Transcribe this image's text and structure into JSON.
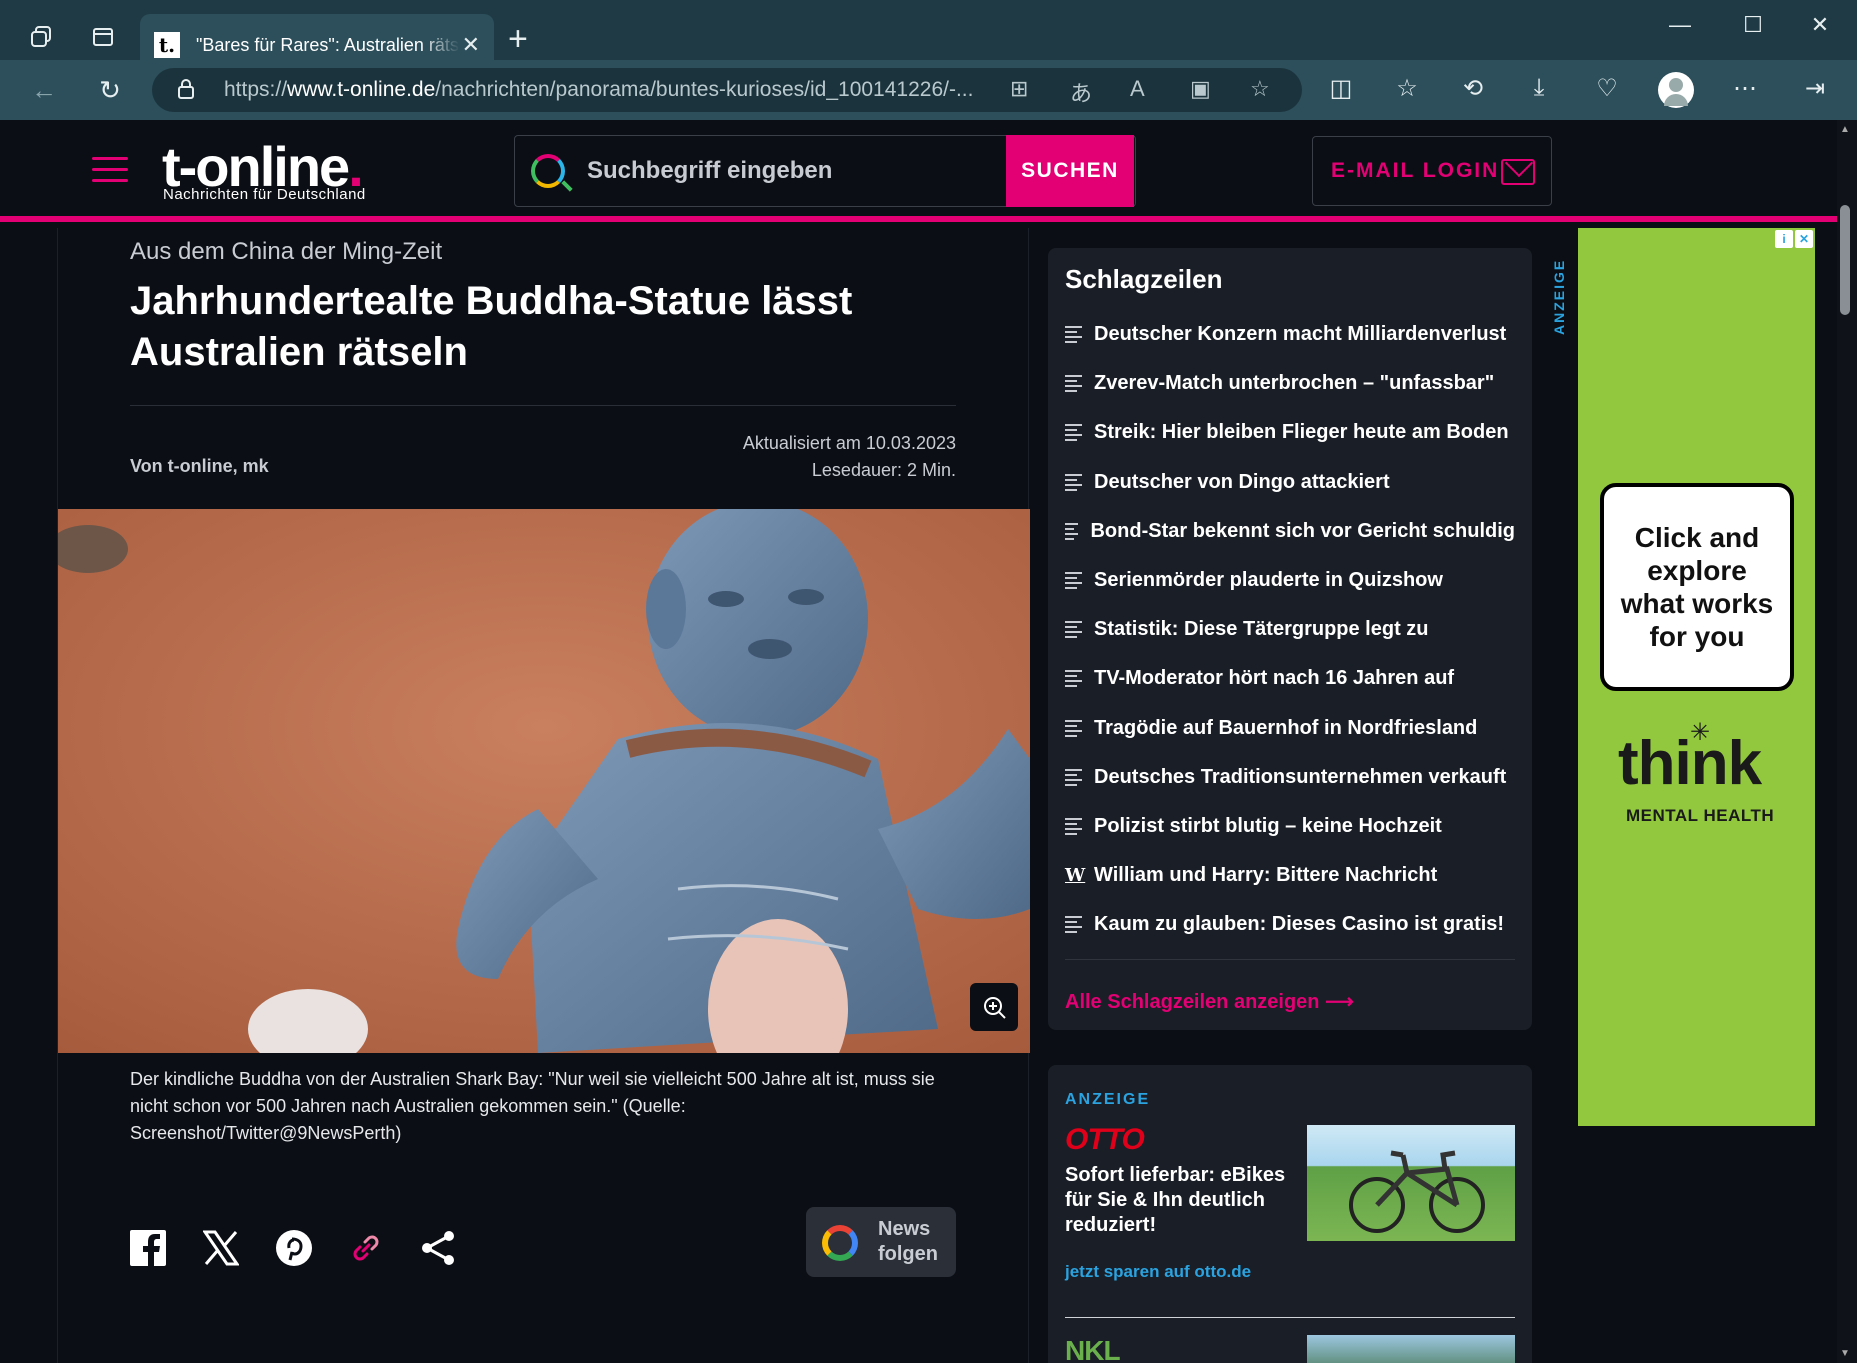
{
  "browser": {
    "tab_title": "\"Bares für Rares\": Australien rätse",
    "tab_favicon": "t.",
    "url_prefix": "https://",
    "url_domain": "www.t-online.de",
    "url_path": "/nachrichten/panorama/buntes-kurioses/id_100141226/-...",
    "icons": [
      "workspaces-icon",
      "tab-actions-icon",
      "close-icon",
      "new-tab-icon",
      "minimize-icon",
      "maximize-icon",
      "window-close-icon",
      "back-icon",
      "refresh-icon",
      "lock-icon",
      "app-available-icon",
      "translate-icon",
      "read-aloud-icon",
      "immersive-reader-icon",
      "favorite-star-icon",
      "split-screen-icon",
      "favorites-icon",
      "history-icon",
      "downloads-icon",
      "browser-essentials-icon",
      "profile-icon",
      "more-icon",
      "sidebar-icon"
    ]
  },
  "header": {
    "logo": "t-online",
    "logo_dot": ".",
    "tagline": "Nachrichten für Deutschland",
    "search_placeholder": "Suchbegriff eingeben",
    "search_button": "SUCHEN",
    "email_login": "E-MAIL LOGIN",
    "brand_color": "#e20074"
  },
  "article": {
    "kicker": "Aus dem China der Ming-Zeit",
    "headline": "Jahrhundertealte Buddha-Statue lässt Australien rätseln",
    "author": "Von t-online, mk",
    "updated": "Aktualisiert am 10.03.2023",
    "reading_time": "Lesedauer: 2 Min.",
    "image_alt": "Blue Buddha figurine held in hand over red sand",
    "caption": "Der kindliche Buddha von der Australien Shark Bay: \"Nur weil sie vielleicht 500 Jahre alt ist, muss sie nicht schon vor 500 Jahren nach Australien gekommen sein.\" (Quelle: Screenshot/Twitter@9NewsPerth)",
    "share_icons": [
      "facebook-icon",
      "x-icon",
      "pinterest-icon",
      "link-icon",
      "share-icon"
    ],
    "google_news": "News folgen",
    "google_news_line1": "News",
    "google_news_line2": "folgen"
  },
  "headlines": {
    "title": "Schlagzeilen",
    "items": [
      {
        "label": "Deutscher Konzern macht Milliardenverlust",
        "icon": "text-icon"
      },
      {
        "label": "Zverev-Match unterbrochen – \"unfassbar\"",
        "icon": "text-icon"
      },
      {
        "label": "Streik: Hier bleiben Flieger heute am Boden",
        "icon": "text-icon"
      },
      {
        "label": "Deutscher von Dingo attackiert",
        "icon": "text-icon"
      },
      {
        "label": "Bond-Star bekennt sich vor Gericht schuldig",
        "icon": "text-icon"
      },
      {
        "label": "Serienmörder plauderte in Quizshow",
        "icon": "text-icon"
      },
      {
        "label": "Statistik: Diese Tätergruppe legt zu",
        "icon": "text-icon"
      },
      {
        "label": "TV-Moderator hört nach 16 Jahren auf",
        "icon": "text-icon"
      },
      {
        "label": "Tragödie auf Bauernhof in Nordfriesland",
        "icon": "text-icon"
      },
      {
        "label": "Deutsches Traditionsunternehmen verkauft",
        "icon": "text-icon"
      },
      {
        "label": "Polizist stirbt blutig – keine Hochzeit",
        "icon": "text-icon"
      },
      {
        "label": "William und Harry: Bittere Nachricht",
        "icon": "w-icon"
      },
      {
        "label": "Kaum zu glauben: Dieses Casino ist gratis!",
        "icon": "text-icon"
      }
    ],
    "all_link": "Alle Schlagzeilen anzeigen"
  },
  "ad_box": {
    "label": "ANZEIGE",
    "brand": "OTTO",
    "text": "Sofort lieferbar: eBikes für Sie & Ihn deutlich reduziert!",
    "link": "jetzt sparen auf otto.de",
    "second_brand": "NKL"
  },
  "skyscraper": {
    "label": "ANZEIGE",
    "card_text": "Click and explore what works for you",
    "brand": "think",
    "brand_sub": "MENTAL HEALTH",
    "bg_color": "#92c83e"
  }
}
